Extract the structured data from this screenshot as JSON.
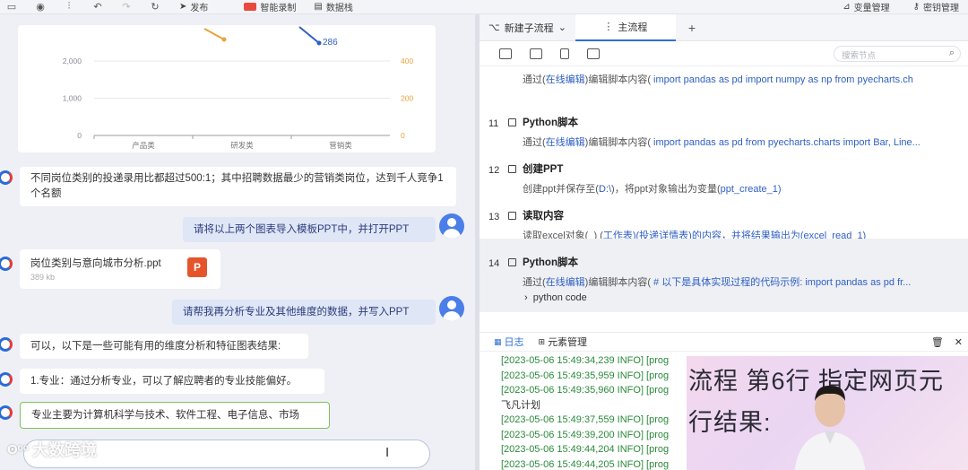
{
  "toolbar": {
    "publish": "发布",
    "smart_record": "智能录制",
    "data_stack": "数据栈",
    "var_manage": "变量管理",
    "pwd_manage": "密钥管理"
  },
  "chart_data": {
    "type": "bar",
    "categories": [
      "产品类",
      "研发类",
      "营销类"
    ],
    "left_ticks": [
      "0",
      "1,000",
      "2,000"
    ],
    "right_ticks": [
      "0",
      "200",
      "400"
    ],
    "left_ylim": [
      0,
      2000
    ],
    "right_ylim": [
      0,
      400
    ],
    "grid": true,
    "annotations": [
      "286"
    ],
    "colors": {
      "line": "#2f5fc4",
      "bar": "#e8a33a",
      "axis_right": "#e8a33a"
    }
  },
  "chat": {
    "bot1": "不同岗位类别的投递录用比都超过500:1；其中招聘数据最少的营销类岗位，达到千人竞争1个名额",
    "user1": "请将以上两个图表导入模板PPT中，并打开PPT",
    "file_name": "岗位类别与意向城市分析.ppt",
    "file_size": "389 kb",
    "file_icon": "P",
    "user2": "请帮我再分析专业及其他维度的数据，并写入PPT",
    "bot2": "可以，以下是一些可能有用的维度分析和特征图表结果:",
    "bot3": "1.专业：通过分析专业，可以了解应聘者的专业技能偏好。",
    "bot4": "专业主要为计算机科学与技术、软件工程、电子信息、市场",
    "watermark": "大数跨境"
  },
  "tabs": {
    "sub_flow": "新建子流程",
    "main_flow": "主流程",
    "plus": "+"
  },
  "search": {
    "placeholder": "搜索节点"
  },
  "steps": [
    {
      "num": "",
      "title": "",
      "desc_pre": "通过(",
      "desc_link": "在线编辑",
      "desc_post": ")编辑脚本内容(",
      "desc_code": " import pandas as pd import numpy as np from pyecharts.ch"
    },
    {
      "num": "11",
      "title": "Python脚本",
      "desc_pre": "通过(",
      "desc_link": "在线编辑",
      "desc_post": ")编辑脚本内容(",
      "desc_code": " import pandas as pd from pyecharts.charts import Bar, Line..."
    },
    {
      "num": "12",
      "title": "创建PPT",
      "desc_pre": "创建ppt并保存至(",
      "desc_link": "D:\\",
      "desc_post": ")，将ppt对象输出为变量(",
      "desc_code": "ppt_create_1)"
    },
    {
      "num": "13",
      "title": "读取内容",
      "desc_pre": "读取excel对象(",
      "desc_link": "_",
      "desc_post": ") (",
      "desc_code": "工作表)(投递详情表)的内容，并将结果输出为(excel_read_1)"
    },
    {
      "num": "14",
      "title": "Python脚本",
      "desc_pre": "通过(",
      "desc_link": "在线编辑",
      "desc_post": ")编辑脚本内容(",
      "desc_code": " # 以下是具体实现过程的代码示例:   import pandas as pd fr..."
    }
  ],
  "step14_extra": "python code",
  "log": {
    "tab_log": "日志",
    "tab_elements": "元素管理",
    "lines": [
      "[2023-05-06 15:49:34,239 INFO] [prog",
      "[2023-05-06 15:49:35,959 INFO] [prog",
      "[2023-05-06 15:49:35,960 INFO] [prog",
      "飞凡计划",
      "[2023-05-06 15:49:37,559 INFO] [prog",
      "[2023-05-06 15:49:39,200 INFO] [prog",
      "[2023-05-06 15:49:44,204 INFO] [prog",
      "[2023-05-06 15:49:44,205 INFO] [prog"
    ]
  },
  "video": {
    "line1": "流程 第6行 指定网页元",
    "line2": "行结果:"
  }
}
